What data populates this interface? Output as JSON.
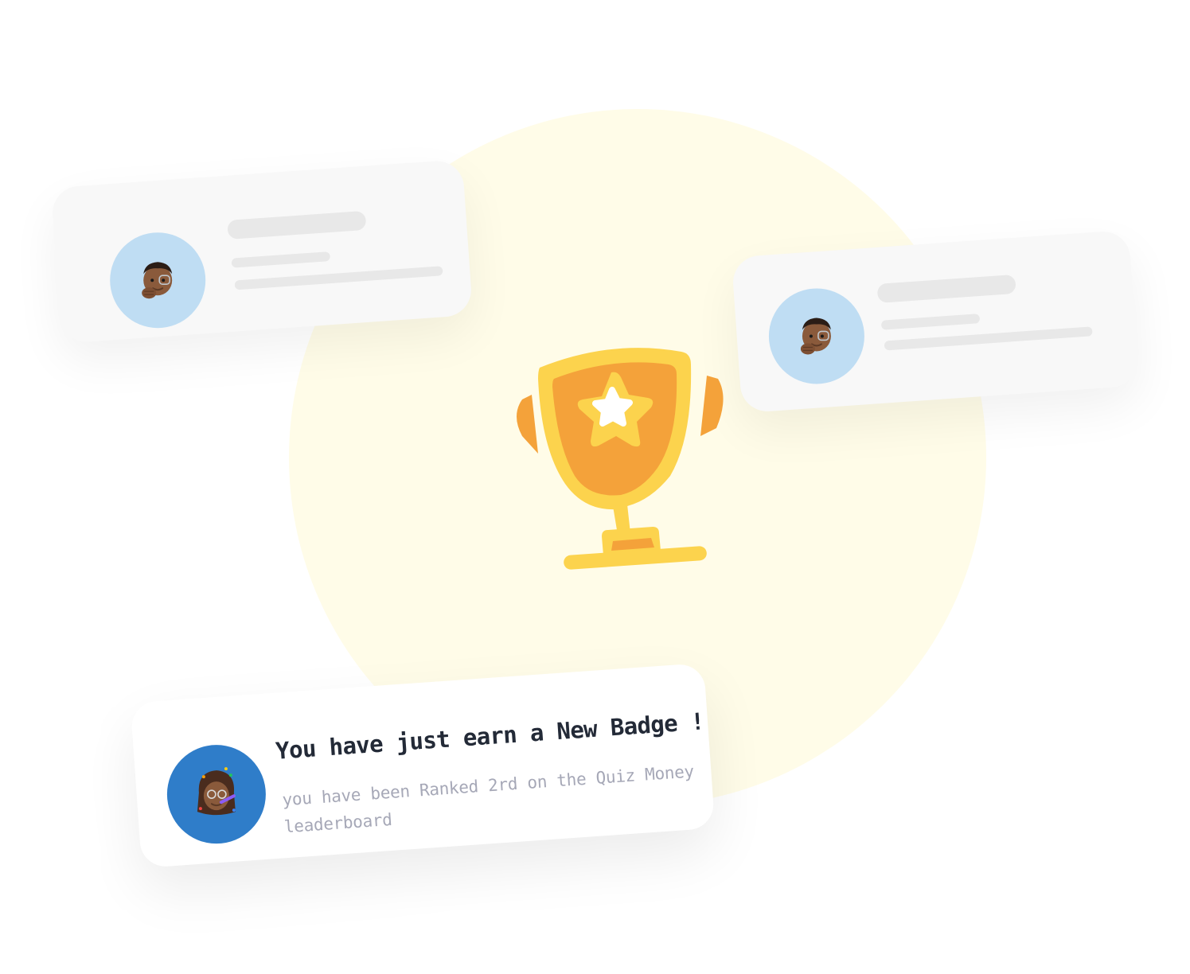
{
  "colors": {
    "background_circle": "#fffce8",
    "card_background": "#f8f8f8",
    "skeleton": "#e8e8e8",
    "avatar_light_blue": "#bfddf3",
    "avatar_blue": "#2f7dc9",
    "trophy_gold": "#fcd34d",
    "trophy_orange": "#f4a23a",
    "title_text": "#232a37",
    "body_text": "#a6a8b7"
  },
  "cards": {
    "left": {
      "avatar_icon": "memoji-man-icon"
    },
    "right": {
      "avatar_icon": "memoji-man-icon"
    }
  },
  "trophy": {
    "icon": "trophy-star-icon"
  },
  "notification": {
    "avatar_icon": "memoji-woman-party-icon",
    "title": "You have just earn a  New Badge !",
    "body": "you have been Ranked 2rd on the Quiz Money leaderboard"
  }
}
